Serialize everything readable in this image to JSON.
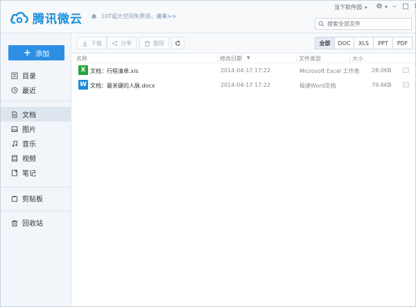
{
  "app": {
    "brand": "腾讯微云",
    "brand_color": "#1a8fdc"
  },
  "notice": {
    "text": "10T超大空间免费领，",
    "link": "速来>>"
  },
  "header": {
    "user_label": "当下软件园",
    "search_placeholder": "搜索全部文件"
  },
  "sidebar": {
    "add_label": "添加",
    "groups": [
      [
        {
          "label": "目录",
          "icon": "directory-icon"
        },
        {
          "label": "最近",
          "icon": "clock-icon"
        }
      ],
      [
        {
          "label": "文档",
          "icon": "document-icon",
          "active": true
        },
        {
          "label": "图片",
          "icon": "image-icon"
        },
        {
          "label": "音乐",
          "icon": "music-icon"
        },
        {
          "label": "视频",
          "icon": "video-icon"
        },
        {
          "label": "笔记",
          "icon": "note-icon"
        }
      ],
      [
        {
          "label": "剪贴板",
          "icon": "clipboard-icon"
        }
      ],
      [
        {
          "label": "回收站",
          "icon": "trash-icon"
        }
      ]
    ]
  },
  "toolbar": {
    "download": "下载",
    "share": "分享",
    "delete": "删除",
    "filters": [
      "全部",
      "DOC",
      "XLS",
      "PPT",
      "PDF"
    ],
    "active_filter": "全部"
  },
  "columns": {
    "name": "名称",
    "modified": "修改日期",
    "type": "文件类型",
    "size": "大小"
  },
  "files": [
    {
      "icon": "X",
      "kind": "xls",
      "name": "文档：行程清单.xls",
      "modified": "2014-04-17 17:22",
      "type": "Microsoft Excel 工作表",
      "size": "28.0KB"
    },
    {
      "icon": "W",
      "kind": "doc",
      "name": "文档：最关键的人脉.docx",
      "modified": "2014-04-17 17:22",
      "type": "极速Word文档",
      "size": "79.6KB"
    }
  ]
}
